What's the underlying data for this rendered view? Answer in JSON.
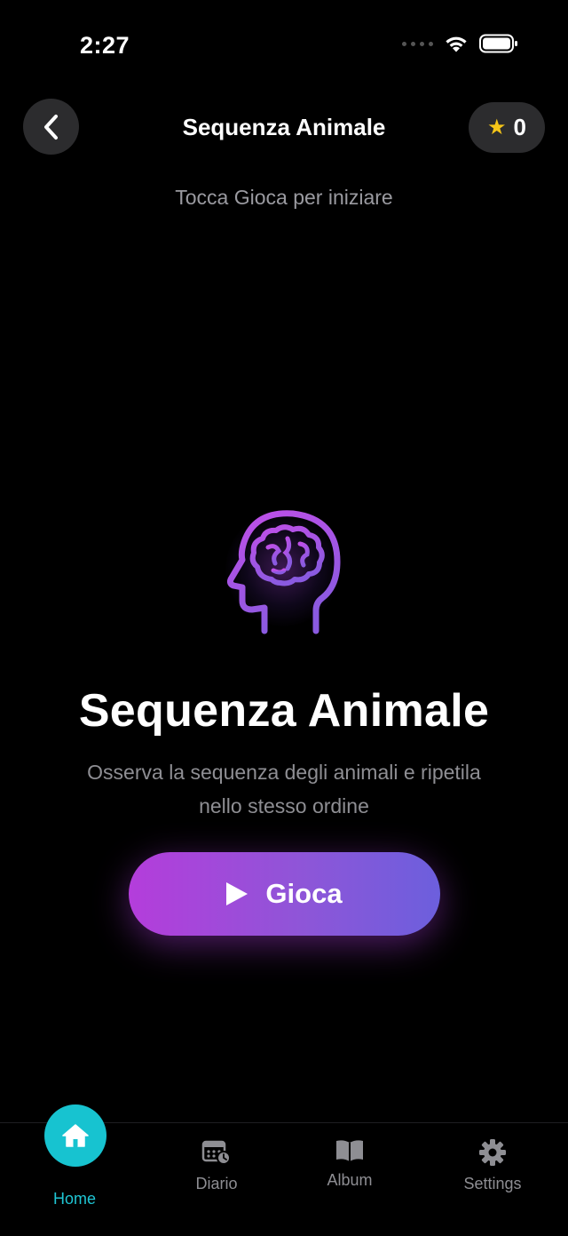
{
  "status_bar": {
    "time": "2:27"
  },
  "nav": {
    "title": "Sequenza Animale",
    "score": "0"
  },
  "hint": "Tocca Gioca per iniziare",
  "game": {
    "title": "Sequenza Animale",
    "description": "Osserva la sequenza degli animali e ripetila nello stesso ordine",
    "play_label": "Gioca"
  },
  "tabs": [
    {
      "label": "Home",
      "icon": "home-icon",
      "active": true
    },
    {
      "label": "Diario",
      "icon": "calendar-clock-icon"
    },
    {
      "label": "Album",
      "icon": "book-icon"
    },
    {
      "label": "Settings",
      "icon": "gear-icon"
    }
  ],
  "colors": {
    "accent_cyan": "#17c3d0",
    "gradient_start": "#b43ddb",
    "gradient_end": "#6c5fdd",
    "star": "#f5c518"
  }
}
